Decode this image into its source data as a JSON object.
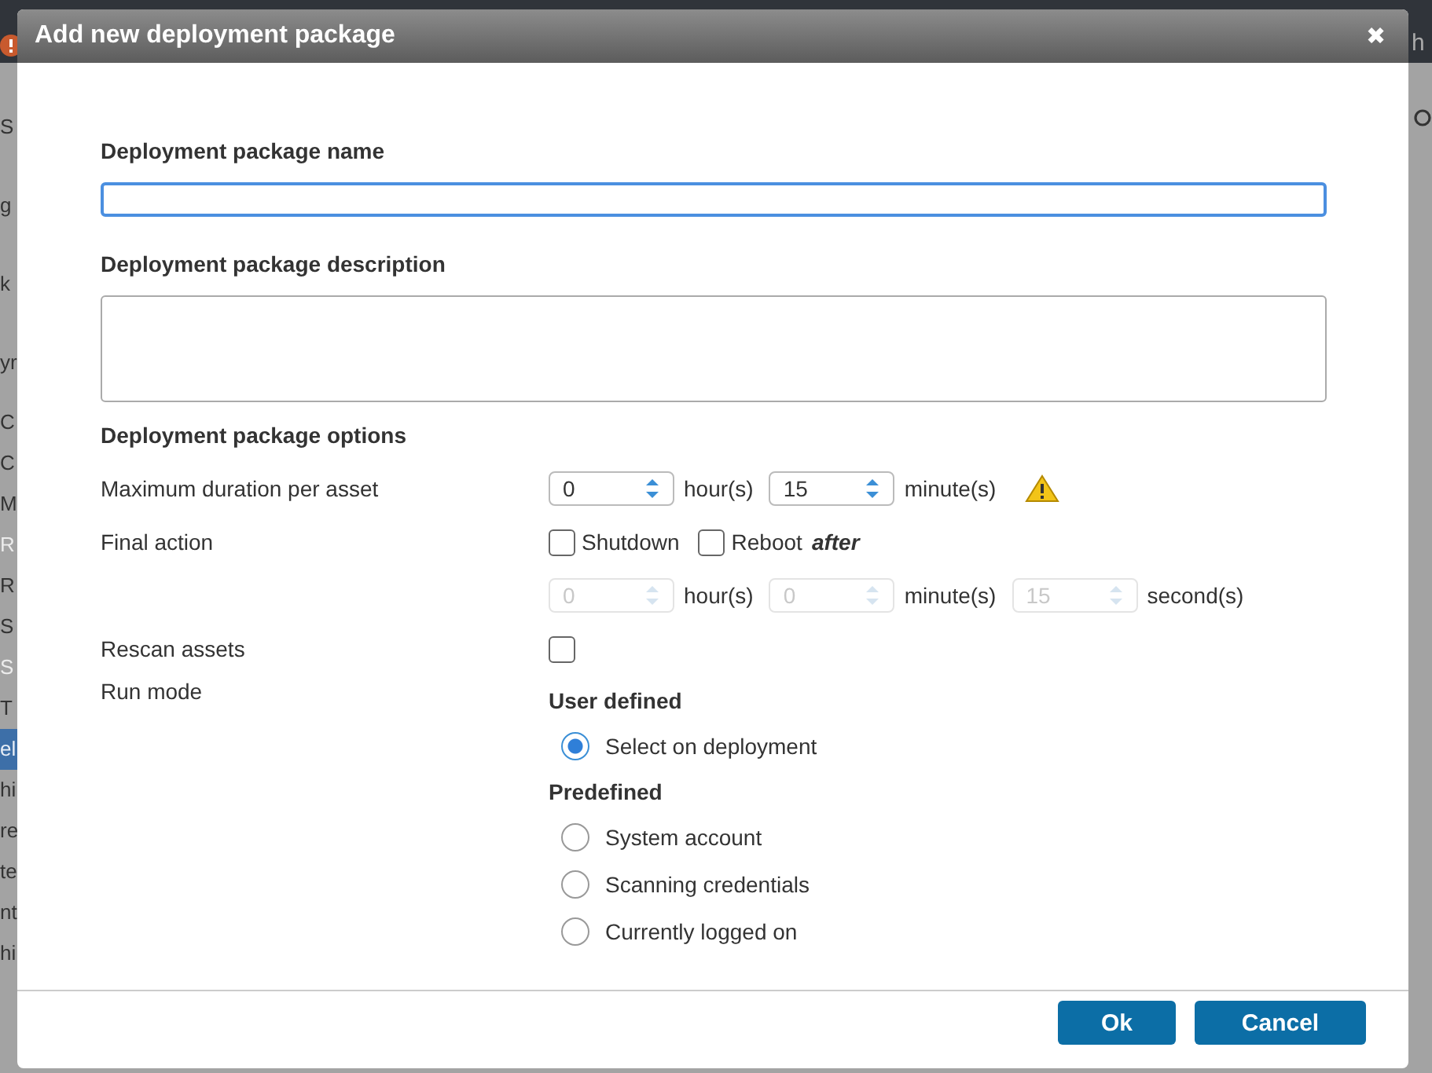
{
  "backdrop": {
    "left_items": [
      {
        "text": "S",
        "selected": false,
        "disabled": false
      },
      {
        "text": "g",
        "selected": false,
        "disabled": false
      },
      {
        "text": "k",
        "selected": false,
        "disabled": false
      },
      {
        "text": "yr",
        "selected": false,
        "disabled": false
      },
      {
        "text": "C",
        "selected": false,
        "disabled": false
      },
      {
        "text": "C",
        "selected": false,
        "disabled": false
      },
      {
        "text": "M",
        "selected": false,
        "disabled": false
      },
      {
        "text": "R",
        "selected": false,
        "disabled": true
      },
      {
        "text": "R",
        "selected": false,
        "disabled": false
      },
      {
        "text": "S",
        "selected": false,
        "disabled": false
      },
      {
        "text": "S",
        "selected": false,
        "disabled": true
      },
      {
        "text": "T",
        "selected": false,
        "disabled": false
      },
      {
        "text": "el",
        "selected": true,
        "disabled": false
      },
      {
        "text": "hi",
        "selected": false,
        "disabled": false
      },
      {
        "text": "re",
        "selected": false,
        "disabled": false
      },
      {
        "text": "te",
        "selected": false,
        "disabled": false
      },
      {
        "text": "nt",
        "selected": false,
        "disabled": false
      },
      {
        "text": "hi",
        "selected": false,
        "disabled": false
      }
    ],
    "right_text": "h"
  },
  "dialog": {
    "title": "Add new deployment package",
    "close": "✖",
    "fields": [
      {
        "label": "Deployment package name",
        "kind": "input",
        "focused": true
      },
      {
        "label": "Deployment package description",
        "kind": "textarea",
        "focused": false
      }
    ],
    "options_heading": "Deployment package options",
    "max_duration": {
      "label": "Maximum duration per asset",
      "warning": true,
      "spinners": [
        {
          "value": "0",
          "unit": "hour(s)",
          "disabled": false
        },
        {
          "value": "15",
          "unit": "minute(s)",
          "disabled": false
        }
      ]
    },
    "final_action": {
      "label": "Final action",
      "checkboxes": [
        {
          "label": "Shutdown",
          "checked": false
        },
        {
          "label": "Reboot",
          "checked": false
        }
      ],
      "suffix": "after",
      "spinners": [
        {
          "value": "0",
          "unit": "hour(s)",
          "disabled": true
        },
        {
          "value": "0",
          "unit": "minute(s)",
          "disabled": true
        },
        {
          "value": "15",
          "unit": "second(s)",
          "disabled": true
        }
      ]
    },
    "rescan": {
      "label": "Rescan assets",
      "checked": false
    },
    "run_mode": {
      "label": "Run mode",
      "groups": [
        {
          "heading": "User defined",
          "options": [
            {
              "label": "Select on deployment",
              "selected": true
            }
          ]
        },
        {
          "heading": "Predefined",
          "options": [
            {
              "label": "System account",
              "selected": false
            },
            {
              "label": "Scanning credentials",
              "selected": false
            },
            {
              "label": "Currently logged on",
              "selected": false
            }
          ]
        }
      ]
    },
    "buttons": [
      {
        "label": "Ok"
      },
      {
        "label": "Cancel"
      }
    ]
  }
}
